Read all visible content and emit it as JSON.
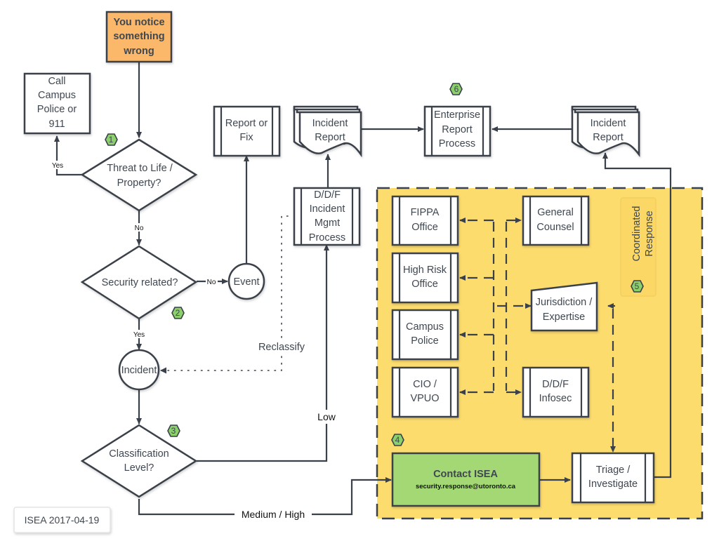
{
  "colors": {
    "start_fill": "#fbb86a",
    "zone_fill": "#fddc6e",
    "contact_fill": "#a3d874",
    "badge_fill": "#8bd06a",
    "stroke": "#3a414a"
  },
  "nodes": {
    "start": [
      "You notice",
      "something",
      "wrong"
    ],
    "call_police": [
      "Call",
      "Campus",
      "Police or",
      "911"
    ],
    "threat": [
      "Threat to Life /",
      "Property?"
    ],
    "security": [
      "Security related?"
    ],
    "event": "Event",
    "incident": "Incident",
    "classification": [
      "Classification",
      "Level?"
    ],
    "report_fix": [
      "Report or",
      "Fix"
    ],
    "incident_report_1": [
      "Incident",
      "Report"
    ],
    "enterprise": [
      "Enterprise",
      "Report",
      "Process"
    ],
    "incident_report_2": [
      "Incident",
      "Report"
    ],
    "ddf_mgmt": [
      "D/D/F",
      "Incident",
      "Mgmt",
      "Process"
    ],
    "fippa": [
      "FIPPA",
      "Office"
    ],
    "high_risk": [
      "High Risk",
      "Office"
    ],
    "campus_police": [
      "Campus",
      "Police"
    ],
    "cio": [
      "CIO /",
      "VPUO"
    ],
    "general_counsel": [
      "General",
      "Counsel"
    ],
    "jurisdiction": [
      "Jurisdiction /",
      "Expertise"
    ],
    "ddf_infosec": [
      "D/D/F",
      "Infosec"
    ],
    "coordinated": [
      "Coordinated",
      "Response"
    ],
    "contact_isea": "Contact ISEA",
    "contact_email": "security.response@utoronto.ca",
    "triage": [
      "Triage /",
      "Investigate"
    ]
  },
  "edge_labels": {
    "yes1": "Yes",
    "no1": "No",
    "no2": "No",
    "yes2": "Yes",
    "reclassify": "Reclassify",
    "low": "Low",
    "medium_high": "Medium / High"
  },
  "badges": [
    "1",
    "2",
    "3",
    "4",
    "5",
    "6"
  ],
  "footer": {
    "version": "ISEA 2017-04-19"
  }
}
